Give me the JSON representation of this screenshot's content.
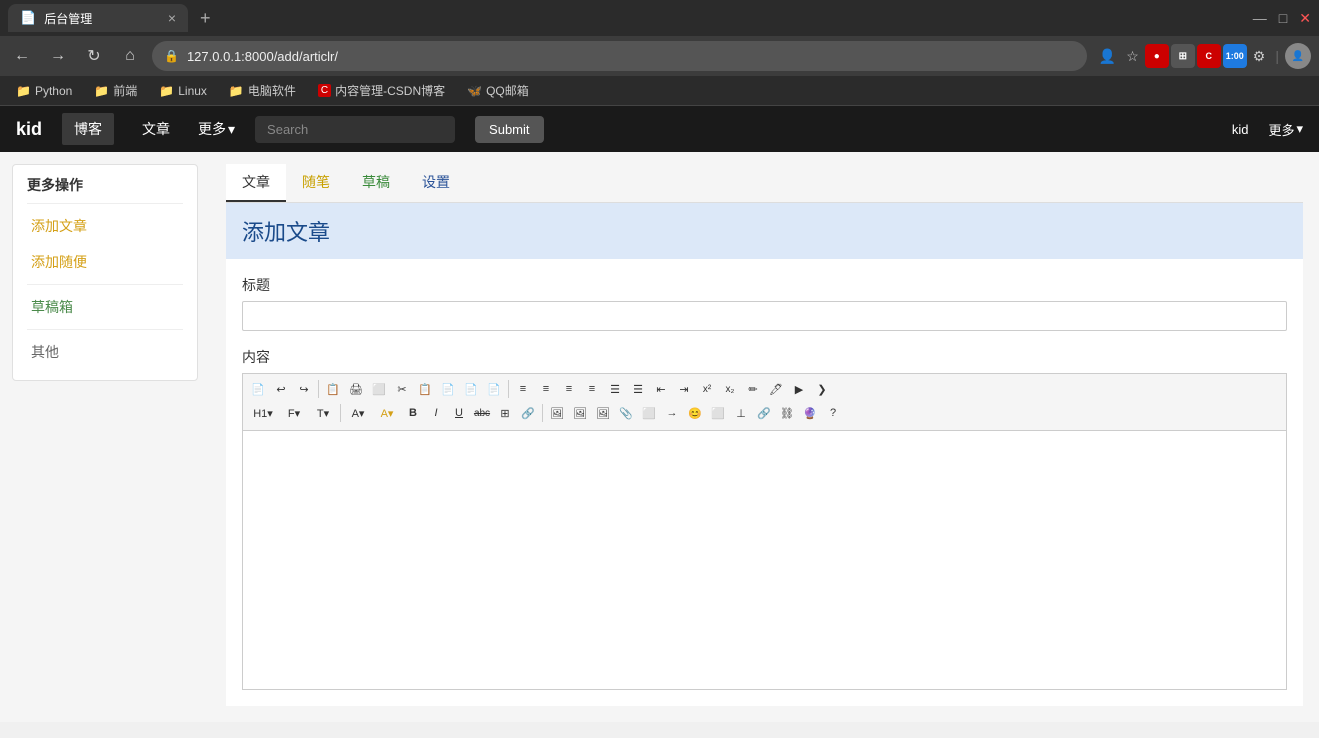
{
  "browser": {
    "tab_title": "后台管理",
    "tab_close": "×",
    "tab_new": "+",
    "win_min": "—",
    "win_max": "□",
    "url": "127.0.0.1:8000/add/articlr/",
    "back": "←",
    "forward": "→",
    "reload": "↻",
    "home": "⌂"
  },
  "bookmarks": [
    {
      "label": "Python",
      "icon": "📁"
    },
    {
      "label": "前端",
      "icon": "📁"
    },
    {
      "label": "Linux",
      "icon": "📁"
    },
    {
      "label": "电脑软件",
      "icon": "📁"
    },
    {
      "label": "内容管理-CSDN博客",
      "icon": "C"
    },
    {
      "label": "QQ邮箱",
      "icon": "🦋"
    }
  ],
  "navbar": {
    "brand": "kid",
    "nav_items": [
      "博客",
      "文章"
    ],
    "nav_more": "更多",
    "search_placeholder": "Search",
    "submit_label": "Submit",
    "user": "kid",
    "more_right": "更多"
  },
  "sidebar": {
    "section_title": "更多操作",
    "links": [
      {
        "label": "添加文章",
        "color": "yellow"
      },
      {
        "label": "添加随便",
        "color": "yellow"
      },
      {
        "label": "草稿箱",
        "color": "green"
      },
      {
        "label": "其他",
        "color": "gray"
      }
    ]
  },
  "main": {
    "tabs": [
      {
        "label": "文章",
        "active": true
      },
      {
        "label": "随笔",
        "color": "yellow"
      },
      {
        "label": "草稿",
        "color": "green"
      },
      {
        "label": "设置",
        "color": "blue"
      }
    ],
    "form_title": "添加文章",
    "title_label": "标题",
    "content_label": "内容",
    "title_placeholder": "",
    "rte_buttons_row1": [
      "📄",
      "↩",
      "↪",
      "📋",
      "🖨",
      "🔲",
      "✂",
      "📄",
      "📄",
      "📄",
      "📄",
      "|",
      "≡",
      "≡",
      "≡",
      "≡",
      "≡",
      "≡",
      "≡",
      "≡",
      "x²",
      "x₂",
      "✏",
      "🖊",
      "▶",
      "❯"
    ],
    "rte_buttons_row2": [
      "H1▾",
      "F▾",
      "T▾",
      "A▾",
      "A▾",
      "B",
      "I",
      "U",
      "abc",
      "⊞",
      "🔗",
      "|",
      "🖼",
      "🖼",
      "🖼",
      "📎",
      "⬜",
      "→",
      "😊",
      "⬜",
      "⊥",
      "🔗",
      "⛓",
      "🔮",
      "?"
    ]
  }
}
